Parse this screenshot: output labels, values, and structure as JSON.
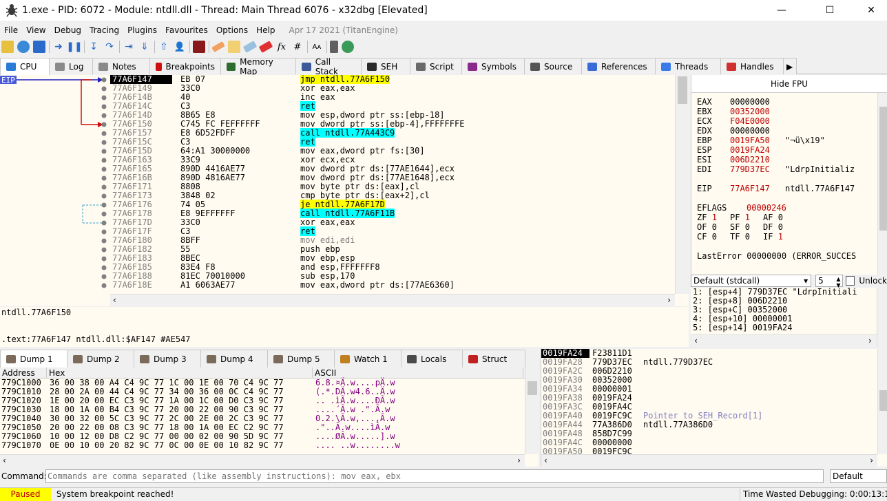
{
  "window": {
    "title": "1.exe - PID: 6072 - Module: ntdll.dll - Thread: Main Thread 6076 - x32dbg [Elevated]",
    "minimize_glyph": "—",
    "maximize_glyph": "☐",
    "close_glyph": "✕"
  },
  "menu": {
    "items": [
      "File",
      "View",
      "Debug",
      "Tracing",
      "Plugins",
      "Favourites",
      "Options",
      "Help"
    ],
    "build_date": "Apr 17 2021 (TitanEngine)"
  },
  "toolbar": {
    "icons": [
      "open-icon",
      "restart-icon",
      "stop-icon",
      "run-icon",
      "pause-icon",
      "step-into-icon",
      "step-over-icon",
      "trace-into-icon",
      "trace-over-icon",
      "execute-till-return-icon",
      "run-to-user-code-icon",
      "scylla-icon",
      "patch-icon",
      "comment-icon",
      "label-icon",
      "bookmark-icon",
      "function-icon",
      "hash-icon",
      "font-icon",
      "calculator-icon",
      "globe-icon"
    ],
    "labels": {
      "function": "fx",
      "hash": "#",
      "font": "Aᴀ"
    }
  },
  "top_tabs": [
    {
      "label": "CPU",
      "color": "#2a7ad8"
    },
    {
      "label": "Log",
      "color": "#8a8a8a"
    },
    {
      "label": "Notes",
      "color": "#8a8a8a"
    },
    {
      "label": "Breakpoints",
      "color": "#d01010"
    },
    {
      "label": "Memory Map",
      "color": "#2f6a2f"
    },
    {
      "label": "Call Stack",
      "color": "#3a5a9a"
    },
    {
      "label": "SEH",
      "color": "#2a2a2a"
    },
    {
      "label": "Script",
      "color": "#6a6a6a"
    },
    {
      "label": "Symbols",
      "color": "#8a2a8a"
    },
    {
      "label": "Source",
      "color": "#555555"
    },
    {
      "label": "References",
      "color": "#3a6ad8"
    },
    {
      "label": "Threads",
      "color": "#3a7ae8"
    },
    {
      "label": "Handles",
      "color": "#d03030"
    }
  ],
  "eip_label": "EIP",
  "disasm": [
    {
      "addr": "77A6F147",
      "bytes": "EB 07",
      "instr": "jmp ntdll.77A6F150",
      "style": "jmp",
      "sel": true
    },
    {
      "addr": "77A6F149",
      "bytes": "33C0",
      "instr": "xor eax,eax"
    },
    {
      "addr": "77A6F14B",
      "bytes": "40",
      "instr": "inc eax"
    },
    {
      "addr": "77A6F14C",
      "bytes": "C3",
      "instr": "ret",
      "style": "ret"
    },
    {
      "addr": "77A6F14D",
      "bytes": "8B65 E8",
      "instr": "mov esp,dword ptr ss:[ebp-18]"
    },
    {
      "addr": "77A6F150",
      "bytes": "C745 FC FEFFFFFF",
      "instr": "mov dword ptr ss:[ebp-4],FFFFFFFE"
    },
    {
      "addr": "77A6F157",
      "bytes": "E8 6D52FDFF",
      "instr": "call ntdll.77A443C9",
      "style": "call"
    },
    {
      "addr": "77A6F15C",
      "bytes": "C3",
      "instr": "ret",
      "style": "ret"
    },
    {
      "addr": "77A6F15D",
      "bytes": "64:A1 30000000",
      "instr": "mov eax,dword ptr fs:[30]"
    },
    {
      "addr": "77A6F163",
      "bytes": "33C9",
      "instr": "xor ecx,ecx"
    },
    {
      "addr": "77A6F165",
      "bytes": "890D 4416AE77",
      "instr": "mov dword ptr ds:[77AE1644],ecx"
    },
    {
      "addr": "77A6F16B",
      "bytes": "890D 4816AE77",
      "instr": "mov dword ptr ds:[77AE1648],ecx"
    },
    {
      "addr": "77A6F171",
      "bytes": "8808",
      "instr": "mov byte ptr ds:[eax],cl"
    },
    {
      "addr": "77A6F173",
      "bytes": "3848 02",
      "instr": "cmp byte ptr ds:[eax+2],cl"
    },
    {
      "addr": "77A6F176",
      "bytes": "74 05",
      "instr": "je ntdll.77A6F17D",
      "style": "jmp"
    },
    {
      "addr": "77A6F178",
      "bytes": "E8 9EFFFFFF",
      "instr": "call ntdll.77A6F11B",
      "style": "call"
    },
    {
      "addr": "77A6F17D",
      "bytes": "33C0",
      "instr": "xor eax,eax"
    },
    {
      "addr": "77A6F17F",
      "bytes": "C3",
      "instr": "ret",
      "style": "ret"
    },
    {
      "addr": "77A6F180",
      "bytes": "8BFF",
      "instr": "mov edi,edi",
      "style": "nop"
    },
    {
      "addr": "77A6F182",
      "bytes": "55",
      "instr": "push ebp"
    },
    {
      "addr": "77A6F183",
      "bytes": "8BEC",
      "instr": "mov ebp,esp"
    },
    {
      "addr": "77A6F185",
      "bytes": "83E4 F8",
      "instr": "and esp,FFFFFFF8"
    },
    {
      "addr": "77A6F188",
      "bytes": "81EC 70010000",
      "instr": "sub esp,170"
    },
    {
      "addr": "77A6F18E",
      "bytes": "A1 6063AE77",
      "instr": "mov eax,dword ptr ds:[77AE6360]"
    }
  ],
  "info": {
    "line1": "ntdll.77A6F150",
    "line2": ".text:77A6F147 ntdll.dll:$AF147 #AE547"
  },
  "registers": {
    "hide_fpu": "Hide FPU",
    "gp": [
      {
        "name": "EAX",
        "value": "00000000",
        "comment": "",
        "changed": false
      },
      {
        "name": "EBX",
        "value": "00352000",
        "comment": "",
        "changed": true
      },
      {
        "name": "ECX",
        "value": "F04E0000",
        "comment": "",
        "changed": true
      },
      {
        "name": "EDX",
        "value": "00000000",
        "comment": "",
        "changed": false
      },
      {
        "name": "EBP",
        "value": "0019FA50",
        "comment": "\"¬ü\\x19\"",
        "changed": true
      },
      {
        "name": "ESP",
        "value": "0019FA24",
        "comment": "",
        "changed": true
      },
      {
        "name": "ESI",
        "value": "006D2210",
        "comment": "",
        "changed": true
      },
      {
        "name": "EDI",
        "value": "779D37EC",
        "comment": "\"LdrpInitializ",
        "changed": true
      }
    ],
    "eip": {
      "name": "EIP",
      "value": "77A6F147",
      "comment": "ntdll.77A6F147"
    },
    "eflags": {
      "name": "EFLAGS",
      "value": "00000246"
    },
    "flags": [
      [
        "ZF",
        "1",
        "PF",
        "1",
        "AF",
        "0"
      ],
      [
        "OF",
        "0",
        "SF",
        "0",
        "DF",
        "0"
      ],
      [
        "CF",
        "0",
        "TF",
        "0",
        "IF",
        "1"
      ]
    ],
    "last_error": "LastError  00000000 (ERROR_SUCCES"
  },
  "callconv": {
    "selected": "Default (stdcall)",
    "count": "5",
    "unlock_label": "Unlock"
  },
  "stack_args": [
    "1: [esp+4] 779D37EC \"LdrpInitiali",
    "2: [esp+8] 006D2210",
    "3: [esp+C] 00352000",
    "4: [esp+10] 00000001",
    "5: [esp+14] 0019FA24"
  ],
  "dump_tabs": [
    {
      "label": "Dump 1",
      "active": true
    },
    {
      "label": "Dump 2"
    },
    {
      "label": "Dump 3"
    },
    {
      "label": "Dump 4"
    },
    {
      "label": "Dump 5"
    },
    {
      "label": "Watch 1"
    },
    {
      "label": "Locals"
    },
    {
      "label": "Struct"
    }
  ],
  "dump": {
    "headers": [
      "Address",
      "Hex",
      "ASCII"
    ],
    "rows": [
      {
        "addr": "779C1000",
        "hex": "36 00 38 00 A4 C4 9C 77 1C 00 1E 00 70 C4 9C 77",
        "ascii": "6.8.¤Ä.w....pÄ.w"
      },
      {
        "addr": "779C1010",
        "hex": "28 00 2A 00 44 C4 9C 77 34 00 36 00 0C C4 9C 77",
        "ascii": "(.*.DÄ.w4.6..Ä.w"
      },
      {
        "addr": "779C1020",
        "hex": "1E 00 20 00 EC C3 9C 77 1A 00 1C 00 D0 C3 9C 77",
        "ascii": ".. .ìÃ.w....ÐÃ.w"
      },
      {
        "addr": "779C1030",
        "hex": "18 00 1A 00 B4 C3 9C 77 20 00 22 00 90 C3 9C 77",
        "ascii": "....´Ã.w .\".Ã.w"
      },
      {
        "addr": "779C1040",
        "hex": "30 00 32 00 5C C3 9C 77 2C 00 2E 00 2C C3 9C 77",
        "ascii": "0.2.\\Ã.w,...,Ã.w"
      },
      {
        "addr": "779C1050",
        "hex": "20 00 22 00 08 C3 9C 77 18 00 1A 00 EC C2 9C 77",
        "ascii": " .\"..Ã.w....ìÂ.w"
      },
      {
        "addr": "779C1060",
        "hex": "10 00 12 00 D8 C2 9C 77 00 00 02 00 90 5D 9C 77",
        "ascii": "....ØÂ.w.....].w"
      },
      {
        "addr": "779C1070",
        "hex": "0E 00 10 00 20 82 9C 77 0C 00 0E 00 10 82 9C 77",
        "ascii": ".... ..w........w"
      }
    ]
  },
  "stack": [
    {
      "addr": "0019FA24",
      "value": "F23811D1",
      "comment": "",
      "top": true
    },
    {
      "addr": "0019FA28",
      "value": "779D37EC",
      "comment": "ntdll.779D37EC"
    },
    {
      "addr": "0019FA2C",
      "value": "006D2210",
      "comment": ""
    },
    {
      "addr": "0019FA30",
      "value": "00352000",
      "comment": ""
    },
    {
      "addr": "0019FA34",
      "value": "00000001",
      "comment": ""
    },
    {
      "addr": "0019FA38",
      "value": "0019FA24",
      "comment": ""
    },
    {
      "addr": "0019FA3C",
      "value": "0019FA4C",
      "comment": ""
    },
    {
      "addr": "0019FA40",
      "value": "0019FC9C",
      "comment": "Pointer to SEH_Record[1]",
      "seh": true
    },
    {
      "addr": "0019FA44",
      "value": "77A386D0",
      "comment": "ntdll.77A386D0"
    },
    {
      "addr": "0019FA48",
      "value": "858D7C99",
      "comment": ""
    },
    {
      "addr": "0019FA4C",
      "value": "00000000",
      "comment": ""
    },
    {
      "addr": "0019FA50",
      "value": "0019FC9C",
      "comment": ""
    }
  ],
  "command": {
    "label": "Command:",
    "placeholder": "Commands are comma separated (like assembly instructions): mov eax, ebx",
    "mode": "Default"
  },
  "status": {
    "state": "Paused",
    "message": "System breakpoint reached!",
    "time_wasted": "Time Wasted Debugging: 0:00:13:18"
  }
}
